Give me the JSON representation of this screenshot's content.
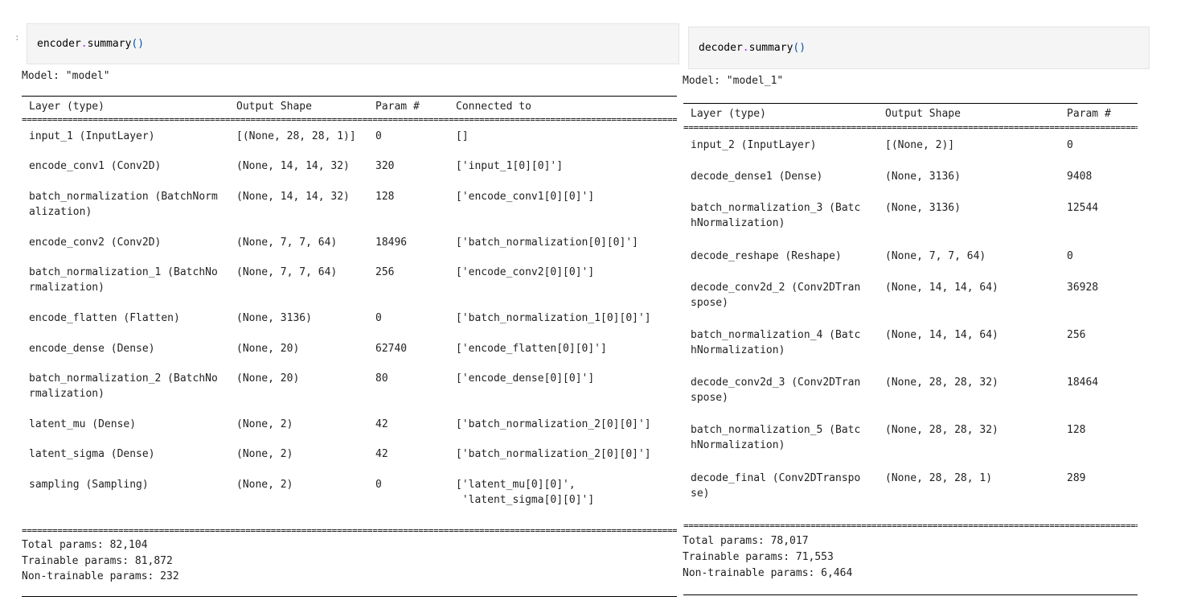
{
  "encoder": {
    "cell_code": {
      "object": "encoder",
      "method": "summary",
      "parens": "()"
    },
    "model_line": "Model: \"model\"",
    "headers": [
      "Layer (type)",
      "Output Shape",
      "Param #",
      "Connected to"
    ],
    "rows": [
      {
        "layer": "input_1 (InputLayer)",
        "shape": "[(None, 28, 28, 1)]",
        "params": "0",
        "conn": "[]"
      },
      {
        "layer": "encode_conv1 (Conv2D)",
        "shape": "(None, 14, 14, 32)",
        "params": "320",
        "conn": "['input_1[0][0]']"
      },
      {
        "layer": "batch_normalization (BatchNorm\nalization)",
        "shape": "(None, 14, 14, 32)",
        "params": "128",
        "conn": "['encode_conv1[0][0]']"
      },
      {
        "layer": "encode_conv2 (Conv2D)",
        "shape": "(None, 7, 7, 64)",
        "params": "18496",
        "conn": "['batch_normalization[0][0]']"
      },
      {
        "layer": "batch_normalization_1 (BatchNo\nrmalization)",
        "shape": "(None, 7, 7, 64)",
        "params": "256",
        "conn": "['encode_conv2[0][0]']"
      },
      {
        "layer": "encode_flatten (Flatten)",
        "shape": "(None, 3136)",
        "params": "0",
        "conn": "['batch_normalization_1[0][0]']"
      },
      {
        "layer": "encode_dense (Dense)",
        "shape": "(None, 20)",
        "params": "62740",
        "conn": "['encode_flatten[0][0]']"
      },
      {
        "layer": "batch_normalization_2 (BatchNo\nrmalization)",
        "shape": "(None, 20)",
        "params": "80",
        "conn": "['encode_dense[0][0]']"
      },
      {
        "layer": "latent_mu (Dense)",
        "shape": "(None, 2)",
        "params": "42",
        "conn": "['batch_normalization_2[0][0]']"
      },
      {
        "layer": "latent_sigma (Dense)",
        "shape": "(None, 2)",
        "params": "42",
        "conn": "['batch_normalization_2[0][0]']"
      },
      {
        "layer": "sampling (Sampling)",
        "shape": "(None, 2)",
        "params": "0",
        "conn": "['latent_mu[0][0]',\n 'latent_sigma[0][0]']"
      }
    ],
    "totals": [
      "Total params: 82,104",
      "Trainable params: 81,872",
      "Non-trainable params: 232"
    ]
  },
  "decoder": {
    "cell_code": {
      "object": "decoder",
      "method": "summary",
      "parens": "()"
    },
    "model_line": "Model: \"model_1\"",
    "headers": [
      "Layer (type)",
      "Output Shape",
      "Param #"
    ],
    "rows": [
      {
        "layer": "input_2 (InputLayer)",
        "shape": "[(None, 2)]",
        "params": "0"
      },
      {
        "layer": "decode_dense1 (Dense)",
        "shape": "(None, 3136)",
        "params": "9408"
      },
      {
        "layer": "batch_normalization_3 (Batc\nhNormalization)",
        "shape": "(None, 3136)",
        "params": "12544"
      },
      {
        "layer": "decode_reshape (Reshape)",
        "shape": "(None, 7, 7, 64)",
        "params": "0"
      },
      {
        "layer": "decode_conv2d_2 (Conv2DTran\nspose)",
        "shape": "(None, 14, 14, 64)",
        "params": "36928"
      },
      {
        "layer": "batch_normalization_4 (Batc\nhNormalization)",
        "shape": "(None, 14, 14, 64)",
        "params": "256"
      },
      {
        "layer": "decode_conv2d_3 (Conv2DTran\nspose)",
        "shape": "(None, 28, 28, 32)",
        "params": "18464"
      },
      {
        "layer": "batch_normalization_5 (Batc\nhNormalization)",
        "shape": "(None, 28, 28, 32)",
        "params": "128"
      },
      {
        "layer": "decode_final (Conv2DTranspo\nse)",
        "shape": "(None, 28, 28, 1)",
        "params": "289"
      }
    ],
    "totals": [
      "Total params: 78,017",
      "Trainable params: 71,553",
      "Non-trainable params: 6,464"
    ]
  },
  "prompt_mark": ":",
  "colors": {
    "cell_bg": "#f5f5f5",
    "method_dot": "#aa22ff",
    "parens": "#0055aa"
  }
}
